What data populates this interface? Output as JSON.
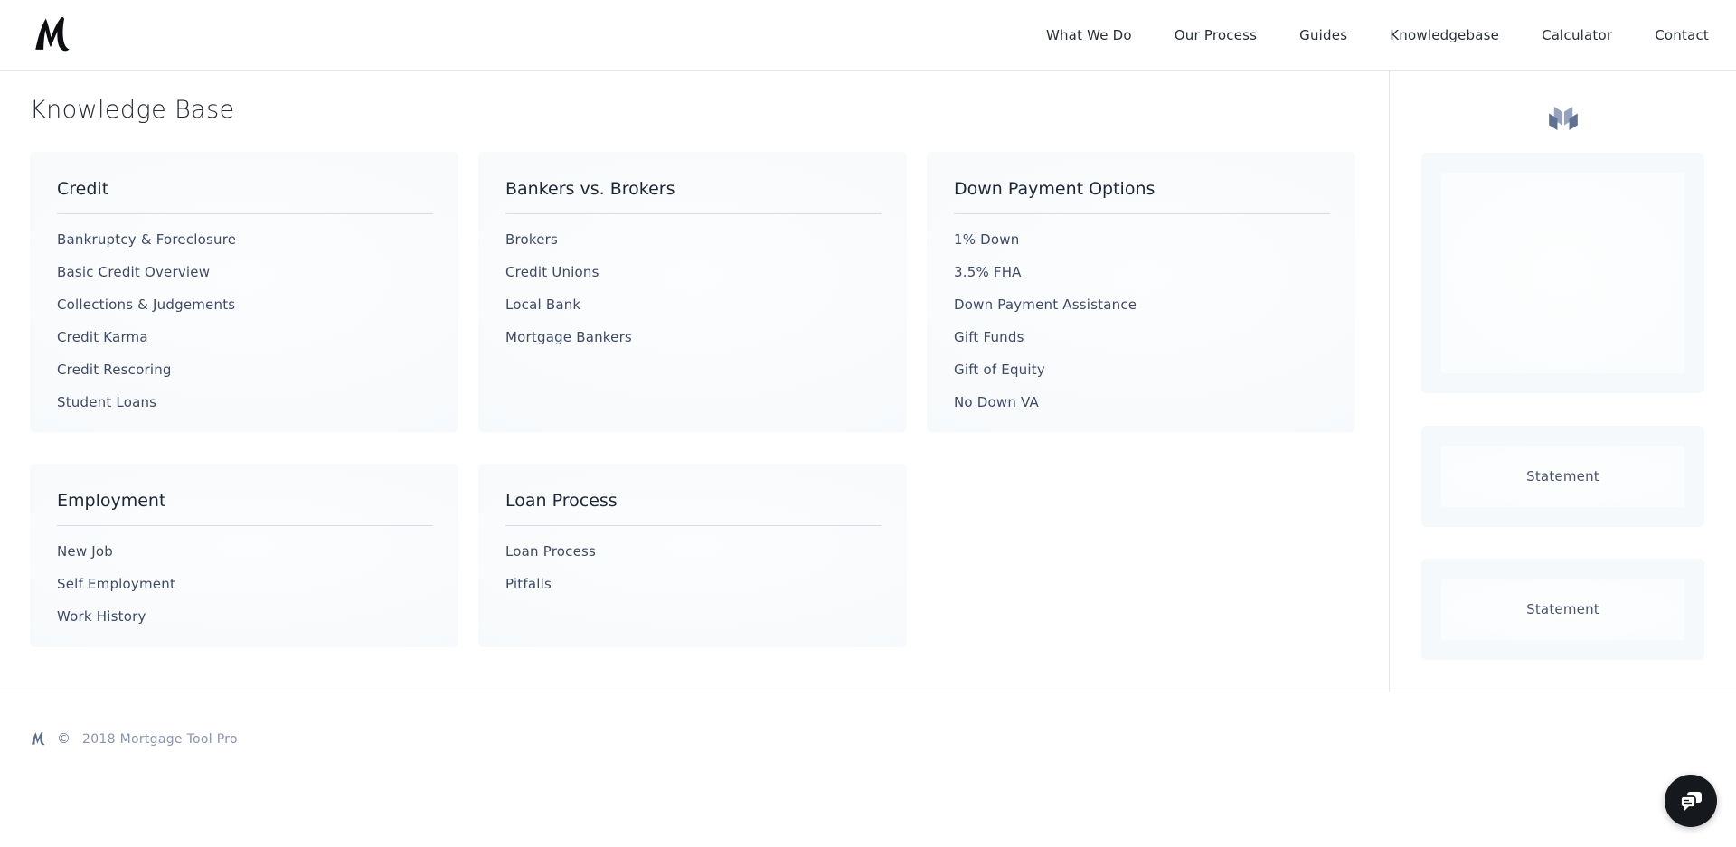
{
  "header": {
    "logo": "m-monogram-logo",
    "nav": [
      {
        "label": "What We Do"
      },
      {
        "label": "Our Process"
      },
      {
        "label": "Guides"
      },
      {
        "label": "Knowledgebase"
      },
      {
        "label": "Calculator"
      },
      {
        "label": "Contact"
      }
    ]
  },
  "page_title": "Knowledge Base",
  "categories": [
    {
      "title": "Credit",
      "links": [
        "Bankruptcy & Foreclosure",
        "Basic Credit Overview",
        "Collections & Judgements",
        "Credit Karma",
        "Credit Rescoring",
        "Student Loans"
      ]
    },
    {
      "title": "Bankers vs. Brokers",
      "links": [
        "Brokers",
        "Credit Unions",
        "Local Bank",
        "Mortgage Bankers"
      ]
    },
    {
      "title": "Down Payment Options",
      "links": [
        "1% Down",
        "3.5% FHA",
        "Down Payment Assistance",
        "Gift Funds",
        "Gift of Equity",
        "No Down VA"
      ]
    },
    {
      "title": "Employment",
      "links": [
        "New Job",
        "Self Employment",
        "Work History"
      ]
    },
    {
      "title": "Loan Process",
      "links": [
        "Loan Process",
        "Pitfalls"
      ]
    }
  ],
  "sidebar": {
    "icon": "open-book-icon",
    "cards": [
      {
        "label": ""
      },
      {
        "label": "Statement"
      },
      {
        "label": "Statement"
      }
    ]
  },
  "footer": {
    "copyright_symbol": "©",
    "text": "2018 Mortgage Tool Pro"
  },
  "chat": {
    "icon": "chat-bubbles-icon"
  },
  "colors": {
    "link": "#3e4a63",
    "card_title": "#1d2736",
    "card_background": "#f8fafc",
    "divider": "#d9dee5",
    "border": "#e3e7ed",
    "nav_text": "#2a2f37",
    "footer_text": "#8b95a9",
    "sidebar_label": "#4a5468",
    "chat_background": "#15181c",
    "book_icon_inner": "#94a3bb",
    "book_icon_outer": "#5f7090",
    "logo": "#0c0e11",
    "footer_logo": "#5d6b85"
  }
}
